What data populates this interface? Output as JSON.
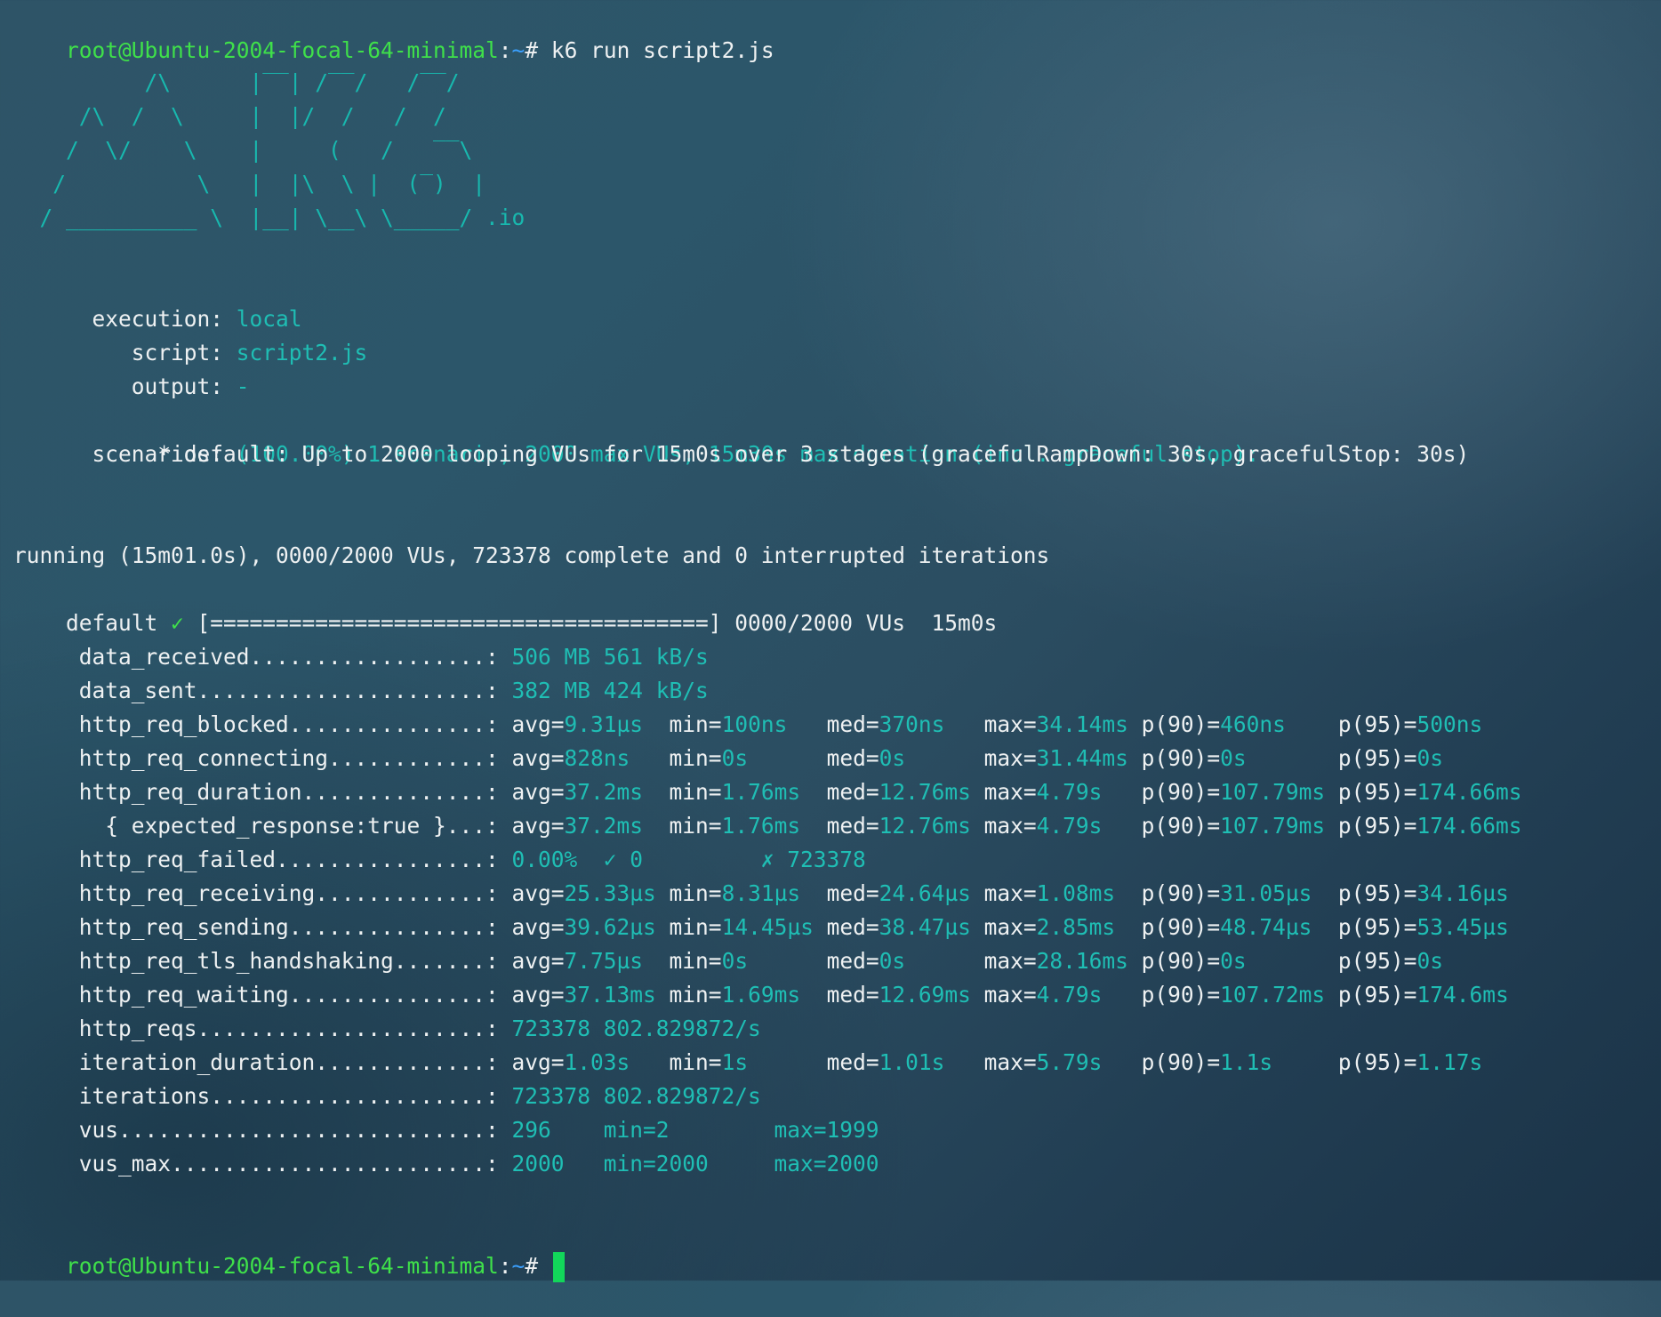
{
  "prompt": {
    "user_host": "root@Ubuntu-2004-focal-64-minimal",
    "colon": ":",
    "path": "~",
    "symbol": "# ",
    "command": "k6 run script2.js"
  },
  "logo": {
    "lines": [
      "          /\\      |‾‾| /‾‾/   /‾‾/",
      "     /\\  /  \\     |  |/  /   /  /",
      "    /  \\/    \\    |     (   /   ‾‾\\",
      "   /          \\   |  |\\  \\ |  (‾)  |",
      "  / __________ \\  |__| \\__\\ \\_____/"
    ],
    "suffix": " .io"
  },
  "config": {
    "execution_label": "  execution: ",
    "execution_value": "local",
    "script_label": "     script: ",
    "script_value": "script2.js",
    "output_label": "     output: ",
    "output_value": "-",
    "scenarios_label": "  scenarios: ",
    "scenarios_value": "(100.00%) 1 scenario, 2000 max VUs, 15m30s max duration (incl. graceful stop):",
    "default_line": "           * default: Up to 2000 looping VUs for 15m0s over 3 stages (gracefulRampDown: 30s, gracefulStop: 30s)"
  },
  "progress": {
    "running_line": "running (15m01.0s), 0000/2000 VUs, 723378 complete and 0 interrupted iterations",
    "default_label": "default ",
    "check_mark": "✓",
    "bar_line": " [======================================] 0000/2000 VUs  15m0s",
    "fraction": 1.0
  },
  "metrics": [
    {
      "name": "     data_received..................: ",
      "cells": [
        {
          "t": "506 MB 561 kB/s",
          "c": "cyan"
        }
      ]
    },
    {
      "name": "     data_sent......................: ",
      "cells": [
        {
          "t": "382 MB 424 kB/s",
          "c": "cyan"
        }
      ]
    },
    {
      "name": "     http_req_blocked...............: ",
      "cells": [
        {
          "t": "avg=",
          "c": "white"
        },
        {
          "t": "9.31µs",
          "c": "cyan"
        },
        {
          "t": "  min=",
          "c": "white"
        },
        {
          "t": "100ns",
          "c": "cyan"
        },
        {
          "t": "   med=",
          "c": "white"
        },
        {
          "t": "370ns",
          "c": "cyan"
        },
        {
          "t": "   max=",
          "c": "white"
        },
        {
          "t": "34.14ms",
          "c": "cyan"
        },
        {
          "t": " p(90)=",
          "c": "white"
        },
        {
          "t": "460ns",
          "c": "cyan"
        },
        {
          "t": "    p(95)=",
          "c": "white"
        },
        {
          "t": "500ns",
          "c": "cyan"
        }
      ]
    },
    {
      "name": "     http_req_connecting............: ",
      "cells": [
        {
          "t": "avg=",
          "c": "white"
        },
        {
          "t": "828ns",
          "c": "cyan"
        },
        {
          "t": "   min=",
          "c": "white"
        },
        {
          "t": "0s",
          "c": "cyan"
        },
        {
          "t": "      med=",
          "c": "white"
        },
        {
          "t": "0s",
          "c": "cyan"
        },
        {
          "t": "      max=",
          "c": "white"
        },
        {
          "t": "31.44ms",
          "c": "cyan"
        },
        {
          "t": " p(90)=",
          "c": "white"
        },
        {
          "t": "0s",
          "c": "cyan"
        },
        {
          "t": "       p(95)=",
          "c": "white"
        },
        {
          "t": "0s",
          "c": "cyan"
        }
      ]
    },
    {
      "name": "     http_req_duration..............: ",
      "cells": [
        {
          "t": "avg=",
          "c": "white"
        },
        {
          "t": "37.2ms",
          "c": "cyan"
        },
        {
          "t": "  min=",
          "c": "white"
        },
        {
          "t": "1.76ms",
          "c": "cyan"
        },
        {
          "t": "  med=",
          "c": "white"
        },
        {
          "t": "12.76ms",
          "c": "cyan"
        },
        {
          "t": " max=",
          "c": "white"
        },
        {
          "t": "4.79s",
          "c": "cyan"
        },
        {
          "t": "   p(90)=",
          "c": "white"
        },
        {
          "t": "107.79ms",
          "c": "cyan"
        },
        {
          "t": " p(95)=",
          "c": "white"
        },
        {
          "t": "174.66ms",
          "c": "cyan"
        }
      ]
    },
    {
      "name": "       { expected_response:true }...: ",
      "cells": [
        {
          "t": "avg=",
          "c": "white"
        },
        {
          "t": "37.2ms",
          "c": "cyan"
        },
        {
          "t": "  min=",
          "c": "white"
        },
        {
          "t": "1.76ms",
          "c": "cyan"
        },
        {
          "t": "  med=",
          "c": "white"
        },
        {
          "t": "12.76ms",
          "c": "cyan"
        },
        {
          "t": " max=",
          "c": "white"
        },
        {
          "t": "4.79s",
          "c": "cyan"
        },
        {
          "t": "   p(90)=",
          "c": "white"
        },
        {
          "t": "107.79ms",
          "c": "cyan"
        },
        {
          "t": " p(95)=",
          "c": "white"
        },
        {
          "t": "174.66ms",
          "c": "cyan"
        }
      ]
    },
    {
      "name": "     http_req_failed................: ",
      "cells": [
        {
          "t": "0.00%",
          "c": "cyan"
        },
        {
          "t": "  ✓ 0",
          "c": "cyan"
        },
        {
          "t": "         ✗ 723378",
          "c": "cyan"
        }
      ]
    },
    {
      "name": "     http_req_receiving.............: ",
      "cells": [
        {
          "t": "avg=",
          "c": "white"
        },
        {
          "t": "25.33µs",
          "c": "cyan"
        },
        {
          "t": " min=",
          "c": "white"
        },
        {
          "t": "8.31µs",
          "c": "cyan"
        },
        {
          "t": "  med=",
          "c": "white"
        },
        {
          "t": "24.64µs",
          "c": "cyan"
        },
        {
          "t": " max=",
          "c": "white"
        },
        {
          "t": "1.08ms",
          "c": "cyan"
        },
        {
          "t": "  p(90)=",
          "c": "white"
        },
        {
          "t": "31.05µs",
          "c": "cyan"
        },
        {
          "t": "  p(95)=",
          "c": "white"
        },
        {
          "t": "34.16µs",
          "c": "cyan"
        }
      ]
    },
    {
      "name": "     http_req_sending...............: ",
      "cells": [
        {
          "t": "avg=",
          "c": "white"
        },
        {
          "t": "39.62µs",
          "c": "cyan"
        },
        {
          "t": " min=",
          "c": "white"
        },
        {
          "t": "14.45µs",
          "c": "cyan"
        },
        {
          "t": " med=",
          "c": "white"
        },
        {
          "t": "38.47µs",
          "c": "cyan"
        },
        {
          "t": " max=",
          "c": "white"
        },
        {
          "t": "2.85ms",
          "c": "cyan"
        },
        {
          "t": "  p(90)=",
          "c": "white"
        },
        {
          "t": "48.74µs",
          "c": "cyan"
        },
        {
          "t": "  p(95)=",
          "c": "white"
        },
        {
          "t": "53.45µs",
          "c": "cyan"
        }
      ]
    },
    {
      "name": "     http_req_tls_handshaking.......: ",
      "cells": [
        {
          "t": "avg=",
          "c": "white"
        },
        {
          "t": "7.75µs",
          "c": "cyan"
        },
        {
          "t": "  min=",
          "c": "white"
        },
        {
          "t": "0s",
          "c": "cyan"
        },
        {
          "t": "      med=",
          "c": "white"
        },
        {
          "t": "0s",
          "c": "cyan"
        },
        {
          "t": "      max=",
          "c": "white"
        },
        {
          "t": "28.16ms",
          "c": "cyan"
        },
        {
          "t": " p(90)=",
          "c": "white"
        },
        {
          "t": "0s",
          "c": "cyan"
        },
        {
          "t": "       p(95)=",
          "c": "white"
        },
        {
          "t": "0s",
          "c": "cyan"
        }
      ]
    },
    {
      "name": "     http_req_waiting...............: ",
      "cells": [
        {
          "t": "avg=",
          "c": "white"
        },
        {
          "t": "37.13ms",
          "c": "cyan"
        },
        {
          "t": " min=",
          "c": "white"
        },
        {
          "t": "1.69ms",
          "c": "cyan"
        },
        {
          "t": "  med=",
          "c": "white"
        },
        {
          "t": "12.69ms",
          "c": "cyan"
        },
        {
          "t": " max=",
          "c": "white"
        },
        {
          "t": "4.79s",
          "c": "cyan"
        },
        {
          "t": "   p(90)=",
          "c": "white"
        },
        {
          "t": "107.72ms",
          "c": "cyan"
        },
        {
          "t": " p(95)=",
          "c": "white"
        },
        {
          "t": "174.6ms",
          "c": "cyan"
        }
      ]
    },
    {
      "name": "     http_reqs......................: ",
      "cells": [
        {
          "t": "723378 802.829872/s",
          "c": "cyan"
        }
      ]
    },
    {
      "name": "     iteration_duration.............: ",
      "cells": [
        {
          "t": "avg=",
          "c": "white"
        },
        {
          "t": "1.03s",
          "c": "cyan"
        },
        {
          "t": "   min=",
          "c": "white"
        },
        {
          "t": "1s",
          "c": "cyan"
        },
        {
          "t": "      med=",
          "c": "white"
        },
        {
          "t": "1.01s",
          "c": "cyan"
        },
        {
          "t": "   max=",
          "c": "white"
        },
        {
          "t": "5.79s",
          "c": "cyan"
        },
        {
          "t": "   p(90)=",
          "c": "white"
        },
        {
          "t": "1.1s",
          "c": "cyan"
        },
        {
          "t": "     p(95)=",
          "c": "white"
        },
        {
          "t": "1.17s",
          "c": "cyan"
        }
      ]
    },
    {
      "name": "     iterations.....................: ",
      "cells": [
        {
          "t": "723378 802.829872/s",
          "c": "cyan"
        }
      ]
    },
    {
      "name": "     vus............................: ",
      "cells": [
        {
          "t": "296",
          "c": "cyan"
        },
        {
          "t": "    min=2",
          "c": "cyan"
        },
        {
          "t": "        max=1999",
          "c": "cyan"
        }
      ]
    },
    {
      "name": "     vus_max........................: ",
      "cells": [
        {
          "t": "2000",
          "c": "cyan"
        },
        {
          "t": "   min=2000",
          "c": "cyan"
        },
        {
          "t": "     max=2000",
          "c": "cyan"
        }
      ]
    }
  ],
  "colors": {
    "prompt_green": "#3fe04a",
    "path_blue": "#3aa0ff",
    "value_cyan": "#1fbeb4",
    "text_white": "#eef1f2",
    "cursor_green": "#12d65a"
  }
}
